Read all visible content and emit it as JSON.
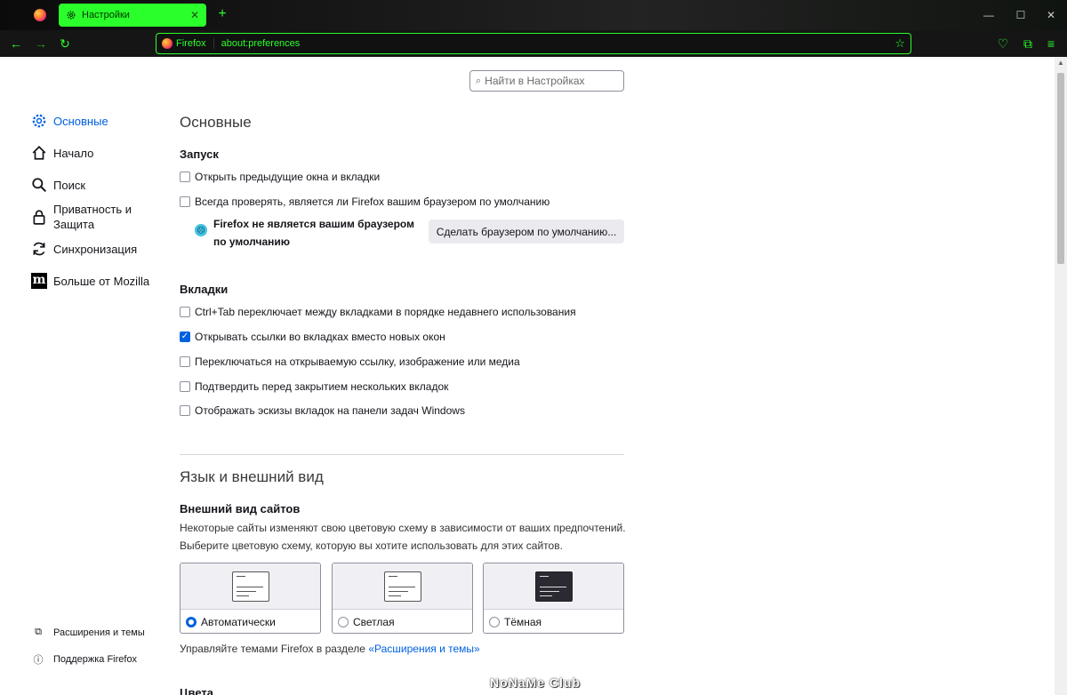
{
  "tab": {
    "title": "Настройки",
    "close": "✕",
    "new": "+"
  },
  "window": {
    "minimize": "—",
    "maximize": "☐",
    "close": "✕"
  },
  "urlbar": {
    "brand": "Firefox",
    "url": "about:preferences"
  },
  "search": {
    "placeholder": "Найти в Настройках"
  },
  "sidebar": {
    "items": [
      {
        "label": "Основные",
        "active": true
      },
      {
        "label": "Начало"
      },
      {
        "label": "Поиск"
      },
      {
        "label": "Приватность и Защита"
      },
      {
        "label": "Синхронизация"
      },
      {
        "label": "Больше от Mozilla"
      }
    ],
    "footer": [
      {
        "label": "Расширения и темы"
      },
      {
        "label": "Поддержка Firefox"
      }
    ]
  },
  "main": {
    "title": "Основные",
    "startup": {
      "heading": "Запуск",
      "options": [
        {
          "label": "Открыть предыдущие окна и вкладки",
          "checked": false
        },
        {
          "label": "Всегда проверять, является ли Firefox вашим браузером по умолчанию",
          "checked": false
        }
      ],
      "default_note": "Firefox не является вашим браузером по умолчанию",
      "default_button": "Сделать браузером по умолчанию..."
    },
    "tabs": {
      "heading": "Вкладки",
      "options": [
        {
          "label": "Ctrl+Tab переключает между вкладками в порядке недавнего использования",
          "checked": false
        },
        {
          "label": "Открывать ссылки во вкладках вместо новых окон",
          "checked": true
        },
        {
          "label": "Переключаться на открываемую ссылку, изображение или медиа",
          "checked": false
        },
        {
          "label": "Подтвердить перед закрытием нескольких вкладок",
          "checked": false
        },
        {
          "label": "Отображать эскизы вкладок на панели задач Windows",
          "checked": false
        }
      ]
    },
    "language": {
      "title": "Язык и внешний вид",
      "appearance_heading": "Внешний вид сайтов",
      "desc1": "Некоторые сайты изменяют свою цветовую схему в зависимости от ваших предпочтений.",
      "desc2": "Выберите цветовую схему, которую вы хотите использовать для этих сайтов.",
      "themes": [
        {
          "label": "Автоматически",
          "selected": true
        },
        {
          "label": "Светлая",
          "selected": false
        },
        {
          "label": "Тёмная",
          "selected": false
        }
      ],
      "manage_text": "Управляйте темами Firefox в разделе ",
      "manage_link": "«Расширения и темы»",
      "next_heading": "Цвета"
    }
  },
  "watermark": "NoNaMe Club"
}
